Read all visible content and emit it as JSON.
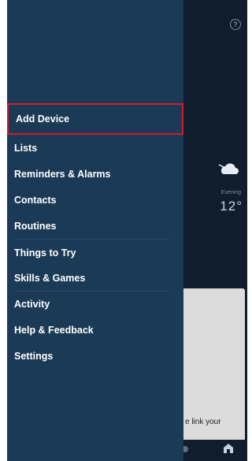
{
  "background": {
    "weather": {
      "period": "Evening",
      "temperature": "12°"
    },
    "card_text": "e link your"
  },
  "drawer": {
    "items": [
      {
        "label": "Add Device"
      },
      {
        "label": "Lists"
      },
      {
        "label": "Reminders & Alarms"
      },
      {
        "label": "Contacts"
      },
      {
        "label": "Routines"
      },
      {
        "label": "Things to Try"
      },
      {
        "label": "Skills & Games"
      },
      {
        "label": "Activity"
      },
      {
        "label": "Help & Feedback"
      },
      {
        "label": "Settings"
      }
    ]
  },
  "colors": {
    "drawer_bg": "#1b3a56",
    "app_bg": "#0f1d2c",
    "highlight_border": "#d31c2a"
  }
}
